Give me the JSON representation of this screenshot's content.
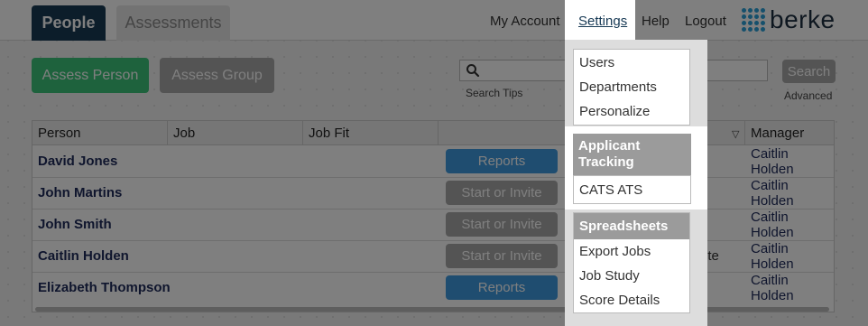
{
  "tabs": {
    "people": "People",
    "assessments": "Assessments"
  },
  "nav": {
    "my_account": "My Account",
    "settings": "Settings",
    "help": "Help",
    "logout": "Logout"
  },
  "logo": {
    "text": "berke"
  },
  "toolbar": {
    "assess_person": "Assess Person",
    "assess_group": "Assess Group",
    "search_tips": "Search Tips",
    "search": "Search",
    "advanced": "Advanced"
  },
  "table": {
    "headers": {
      "person": "Person",
      "job": "Job",
      "job_fit": "Job Fit",
      "manager": "Manager"
    },
    "rows": [
      {
        "person": "David Jones",
        "action": "Reports",
        "manager": "Caitlin Holden"
      },
      {
        "person": "John Martins",
        "action": "Start or Invite",
        "manager": "Caitlin Holden"
      },
      {
        "person": "John Smith",
        "action": "Start or Invite",
        "manager": "Caitlin Holden"
      },
      {
        "person": "Caitlin Holden",
        "action": "Start or Invite",
        "manager": "Caitlin Holden",
        "partial": "ete"
      },
      {
        "person": "Elizabeth Thompson",
        "action": "Reports",
        "manager": "Caitlin Holden"
      }
    ]
  },
  "settings_menu": {
    "general": [
      "Users",
      "Departments",
      "Personalize"
    ],
    "applicant_tracking": {
      "title": "Applicant Tracking",
      "items": [
        "CATS ATS"
      ]
    },
    "spreadsheets": {
      "title": "Spreadsheets",
      "items": [
        "Export Jobs",
        "Job Study",
        "Score Details"
      ]
    }
  }
}
